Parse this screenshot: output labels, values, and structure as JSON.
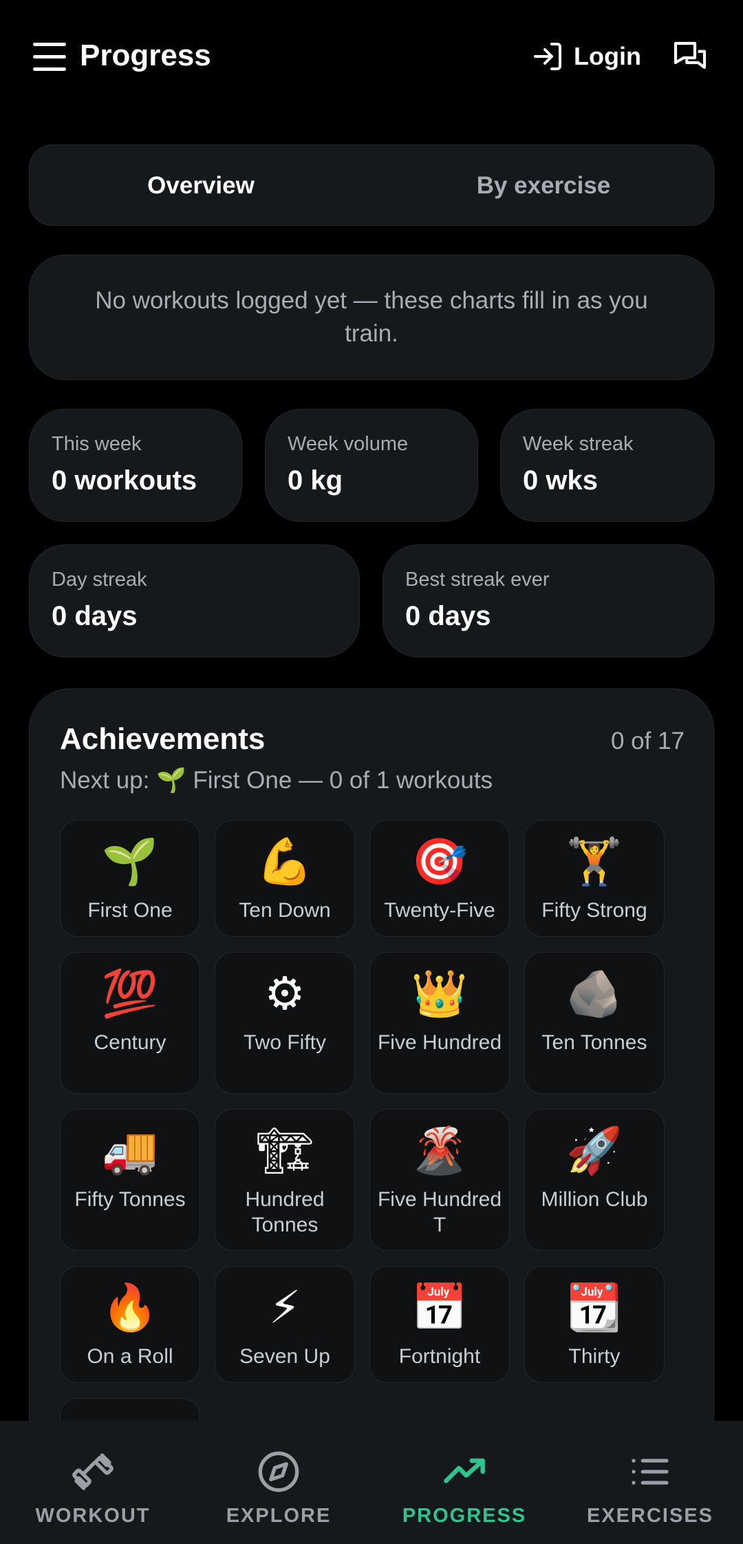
{
  "header": {
    "title": "Progress",
    "login_label": "Login",
    "icons": {
      "menu": "menu-icon",
      "login": "login-icon",
      "chat": "chat-icon"
    }
  },
  "tabs": [
    {
      "label": "Overview",
      "active": true
    },
    {
      "label": "By exercise",
      "active": false
    }
  ],
  "notice": "No workouts logged yet — these charts fill in as you train.",
  "stats": [
    {
      "label": "This week",
      "value": "0 workouts"
    },
    {
      "label": "Week volume",
      "value": "0 kg"
    },
    {
      "label": "Week streak",
      "value": "0 wks"
    },
    {
      "label": "Day streak",
      "value": "0 days"
    },
    {
      "label": "Best streak ever",
      "value": "0 days"
    }
  ],
  "achievements": {
    "title": "Achievements",
    "count": "0 of 17",
    "next_up": "Next up: 🌱 First One — 0 of 1 workouts",
    "badges": [
      {
        "emoji": "🌱",
        "name": "First One"
      },
      {
        "emoji": "💪",
        "name": "Ten Down"
      },
      {
        "emoji": "🎯",
        "name": "Twenty-Five"
      },
      {
        "emoji": "🏋",
        "name": "Fifty Strong"
      },
      {
        "emoji": "💯",
        "name": "Century"
      },
      {
        "emoji": "⚙",
        "name": "Two Fifty"
      },
      {
        "emoji": "👑",
        "name": "Five Hundred"
      },
      {
        "emoji": "🪨",
        "name": "Ten Tonnes"
      },
      {
        "emoji": "🚚",
        "name": "Fifty Tonnes"
      },
      {
        "emoji": "🏗",
        "name": "Hundred Tonnes"
      },
      {
        "emoji": "🌋",
        "name": "Five Hundred T"
      },
      {
        "emoji": "🚀",
        "name": "Million Club"
      },
      {
        "emoji": "🔥",
        "name": "On a Roll"
      },
      {
        "emoji": "⚡",
        "name": "Seven Up"
      },
      {
        "emoji": "📅",
        "name": "Fortnight"
      },
      {
        "emoji": "📆",
        "name": "Thirty"
      }
    ]
  },
  "nav": [
    {
      "label": "WORKOUT",
      "icon": "dumbbell-icon",
      "active": false
    },
    {
      "label": "EXPLORE",
      "icon": "compass-icon",
      "active": false
    },
    {
      "label": "PROGRESS",
      "icon": "trending-up-icon",
      "active": true
    },
    {
      "label": "EXERCISES",
      "icon": "list-icon",
      "active": false
    }
  ],
  "colors": {
    "background": "#000000",
    "card": "#16191c",
    "muted_text": "#a7adb3",
    "accent": "#2fc48f"
  }
}
